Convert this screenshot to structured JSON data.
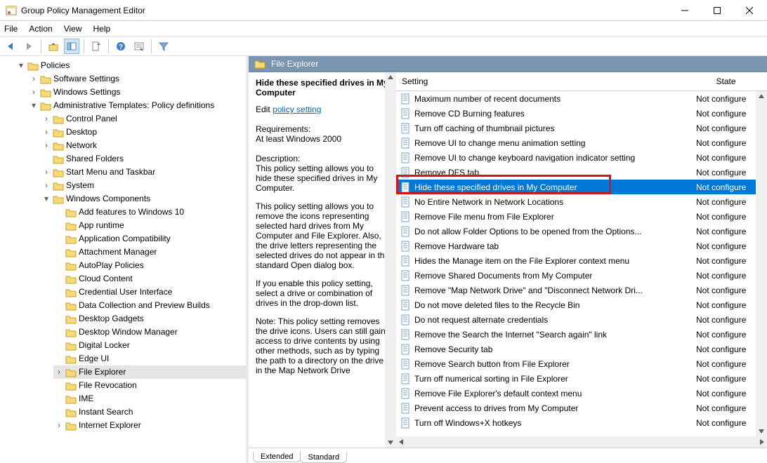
{
  "window": {
    "title": "Group Policy Management Editor"
  },
  "menus": {
    "file": "File",
    "action": "Action",
    "view": "View",
    "help": "Help"
  },
  "tree": {
    "policies": "Policies",
    "software_settings": "Software Settings",
    "windows_settings": "Windows Settings",
    "admin_templates": "Administrative Templates: Policy definitions",
    "control_panel": "Control Panel",
    "desktop": "Desktop",
    "network": "Network",
    "shared_folders": "Shared Folders",
    "start_menu": "Start Menu and Taskbar",
    "system": "System",
    "windows_components": "Windows Components",
    "wc": {
      "add_features": "Add features to Windows 10",
      "app_runtime": "App runtime",
      "app_compat": "Application Compatibility",
      "attachment_mgr": "Attachment Manager",
      "autoplay": "AutoPlay Policies",
      "cloud_content": "Cloud Content",
      "cred_ui": "Credential User Interface",
      "data_collection": "Data Collection and Preview Builds",
      "desktop_gadgets": "Desktop Gadgets",
      "dwm": "Desktop Window Manager",
      "digital_locker": "Digital Locker",
      "edge_ui": "Edge UI",
      "file_explorer": "File Explorer",
      "file_revocation": "File Revocation",
      "ime": "IME",
      "instant_search": "Instant Search",
      "internet_explorer": "Internet Explorer"
    }
  },
  "category": {
    "title": "File Explorer"
  },
  "desc": {
    "title": "Hide these specified drives in My Computer",
    "edit": "Edit",
    "link": "policy setting",
    "req_label": "Requirements:",
    "req_value": "At least Windows 2000",
    "desc_label": "Description:",
    "p1": "This policy setting allows you to hide these specified drives in My Computer.",
    "p2": "This policy setting allows you to remove the icons representing selected hard drives from My Computer and File Explorer. Also, the drive letters representing the selected drives do not appear in the standard Open dialog box.",
    "p3": "If you enable this policy setting, select a drive or combination of drives in the drop-down list.",
    "p4": "Note: This policy setting removes the drive icons. Users can still gain access to drive contents by using other methods, such as by typing the path to a directory on the drive in the Map Network Drive"
  },
  "list": {
    "header_setting": "Setting",
    "header_state": "State",
    "state_nc": "Not configure",
    "items": [
      "Maximum number of recent documents",
      "Remove CD Burning features",
      "Turn off caching of thumbnail pictures",
      "Remove UI to change menu animation setting",
      "Remove UI to change keyboard navigation indicator setting",
      "Remove DFS tab",
      "Hide these specified drives in My Computer",
      "No Entire Network in Network Locations",
      "Remove File menu from File Explorer",
      "Do not allow Folder Options to be opened from the Options...",
      "Remove Hardware tab",
      "Hides the Manage item on the File Explorer context menu",
      "Remove Shared Documents from My Computer",
      "Remove \"Map Network Drive\" and \"Disconnect Network Dri...",
      "Do not move deleted files to the Recycle Bin",
      "Do not request alternate credentials",
      "Remove the Search the Internet \"Search again\" link",
      "Remove Security tab",
      "Remove Search button from File Explorer",
      "Turn off numerical sorting in File Explorer",
      "Remove File Explorer's default context menu",
      "Prevent access to drives from My Computer",
      "Turn off Windows+X hotkeys"
    ],
    "selected_index": 6
  },
  "tabs": {
    "extended": "Extended",
    "standard": "Standard"
  }
}
